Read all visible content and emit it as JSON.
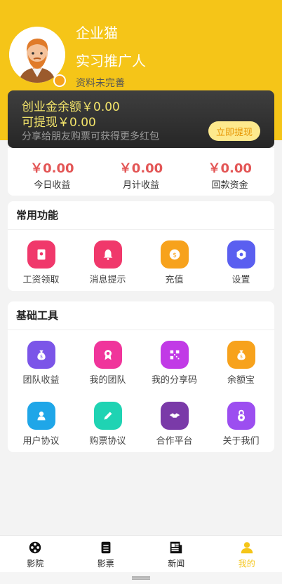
{
  "profile": {
    "company": "企业猫",
    "nickname": "实习推广人",
    "hint": "资料未完善"
  },
  "balance": {
    "corp_balance": "创业金余额￥0.00",
    "withdrawable": "可提现￥0.00",
    "tip": "分享给朋友购票可获得更多红包",
    "withdraw_button": "立即提现"
  },
  "stats": [
    {
      "value": "￥0.00",
      "label": "今日收益"
    },
    {
      "value": "￥0.00",
      "label": "月计收益"
    },
    {
      "value": "￥0.00",
      "label": "回款资金"
    }
  ],
  "common_functions": {
    "title": "常用功能",
    "items": [
      {
        "label": "工资领取",
        "icon": "red-envelope-icon",
        "color": "#f0386b"
      },
      {
        "label": "消息提示",
        "icon": "bell-icon",
        "color": "#f0386b"
      },
      {
        "label": "充值",
        "icon": "coin-icon",
        "color": "#f7a21c"
      },
      {
        "label": "设置",
        "icon": "gear-icon",
        "color": "#5a5ff0"
      }
    ]
  },
  "basic_tools": {
    "title": "基础工具",
    "items": [
      {
        "label": "团队收益",
        "icon": "money-bag-icon",
        "color": "#7b55e8"
      },
      {
        "label": "我的团队",
        "icon": "medal-icon",
        "color": "#f0359b"
      },
      {
        "label": "我的分享码",
        "icon": "qr-code-icon",
        "color": "#c13ae6"
      },
      {
        "label": "余额宝",
        "icon": "coin-bag-icon",
        "color": "#f7a21c"
      },
      {
        "label": "用户协议",
        "icon": "user-icon",
        "color": "#1fa6e8"
      },
      {
        "label": "购票协议",
        "icon": "pencil-icon",
        "color": "#1fd3b3"
      },
      {
        "label": "合作平台",
        "icon": "handshake-icon",
        "color": "#7a3aa8"
      },
      {
        "label": "关于我们",
        "icon": "lock-icon",
        "color": "#9c4ef0"
      }
    ]
  },
  "tabbar": [
    {
      "label": "影院",
      "icon": "film-reel-icon"
    },
    {
      "label": "影票",
      "icon": "ticket-list-icon"
    },
    {
      "label": "新闻",
      "icon": "newspaper-icon"
    },
    {
      "label": "我的",
      "icon": "person-icon",
      "active": true
    }
  ]
}
